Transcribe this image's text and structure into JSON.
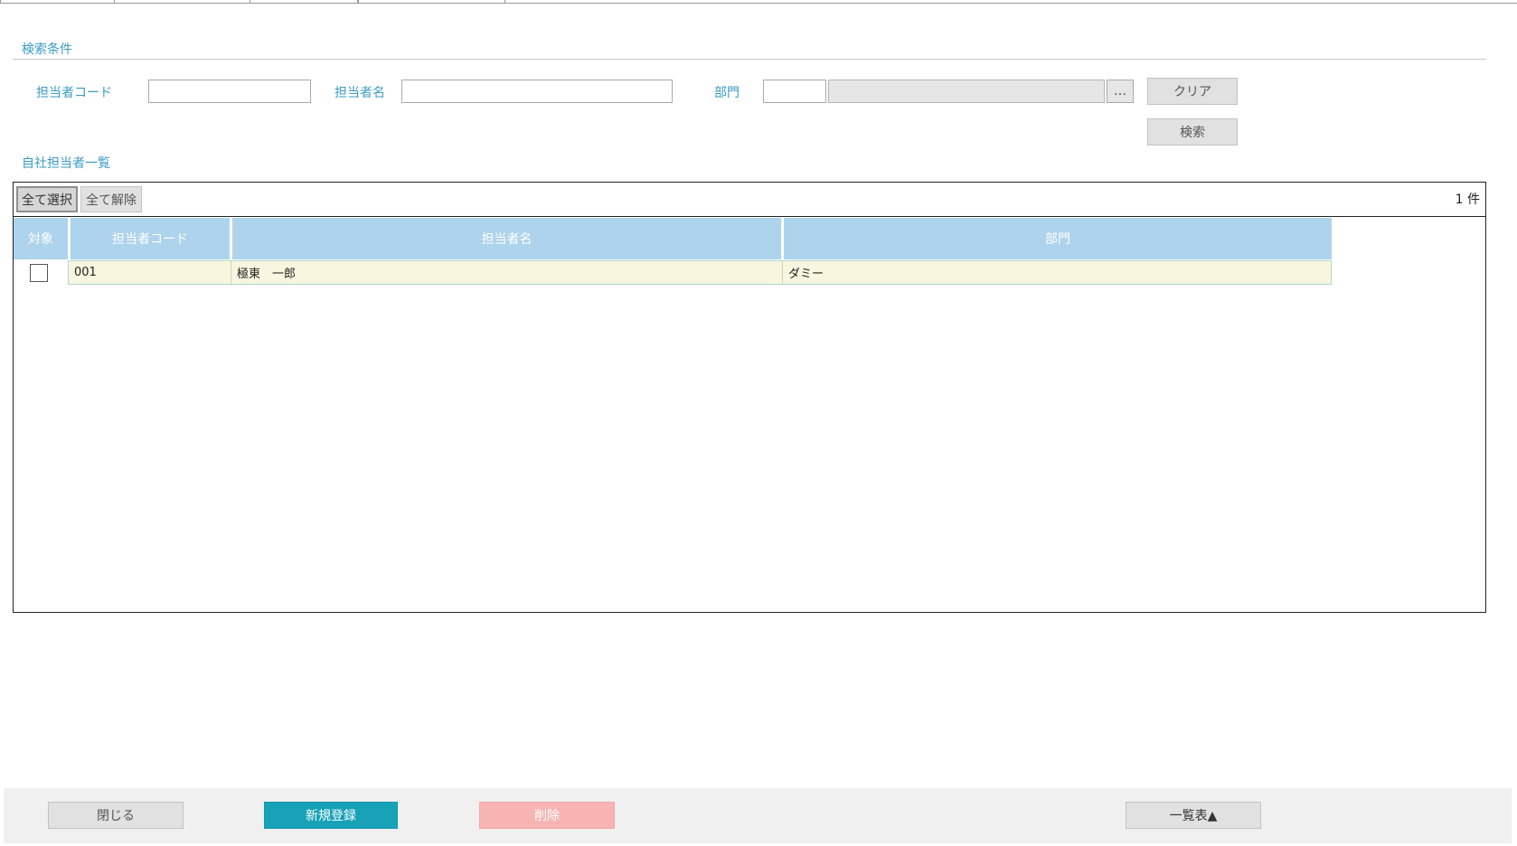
{
  "search": {
    "section_title": "検索条件",
    "staff_code_label": "担当者コード",
    "staff_code_value": "",
    "staff_name_label": "担当者名",
    "staff_name_value": "",
    "dept_label": "部門",
    "dept_code_value": "",
    "dept_name_value": "",
    "dept_lookup_label": "…",
    "clear_label": "クリア",
    "search_label": "検索"
  },
  "list": {
    "section_title": "自社担当者一覧",
    "select_all_label": "全て選択",
    "deselect_all_label": "全て解除",
    "count_text": "1 件",
    "columns": [
      "対象",
      "担当者コード",
      "担当者名",
      "部門"
    ],
    "rows": [
      {
        "checked": false,
        "code": "001",
        "name": "極東　一郎",
        "dept": "ダミー"
      }
    ]
  },
  "footer": {
    "close_label": "閉じる",
    "new_label": "新規登録",
    "delete_label": "削除",
    "list_label": "一覧表▲"
  },
  "colors": {
    "accent_label": "#3a9bc4",
    "header_bg": "#aed3ec",
    "row_bg": "#f8f6df",
    "new_button": "#17a2b8",
    "delete_button": "#f8b3b3"
  }
}
